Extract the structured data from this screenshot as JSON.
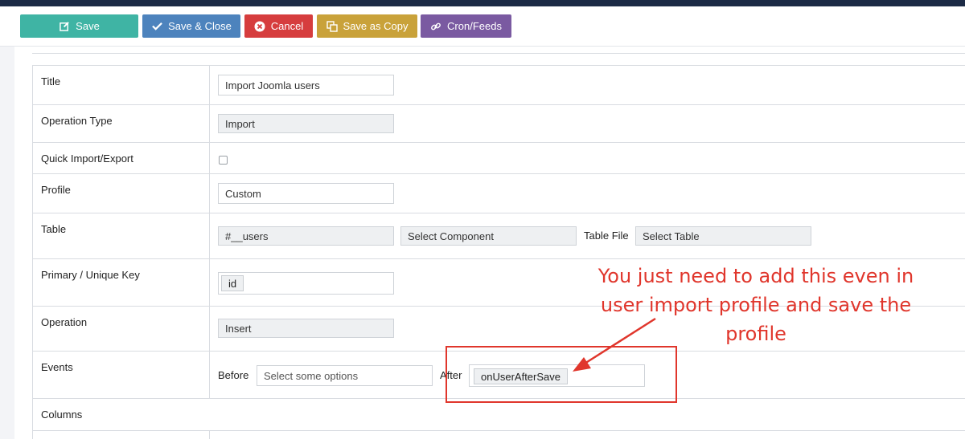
{
  "toolbar": {
    "save": "Save",
    "save_close": "Save & Close",
    "cancel": "Cancel",
    "save_copy": "Save as Copy",
    "cron": "Cron/Feeds"
  },
  "form": {
    "title": {
      "label": "Title",
      "value": "Import Joomla users"
    },
    "operation_type": {
      "label": "Operation Type",
      "value": "Import"
    },
    "quick": {
      "label": "Quick Import/Export",
      "checked": false
    },
    "profile": {
      "label": "Profile",
      "value": "Custom"
    },
    "table": {
      "label": "Table",
      "value": "#__users",
      "component_placeholder": "Select Component",
      "table_file_label": "Table File",
      "table_placeholder": "Select Table"
    },
    "primary_key": {
      "label": "Primary / Unique Key",
      "value": "id"
    },
    "operation": {
      "label": "Operation",
      "value": "Insert"
    },
    "events": {
      "label": "Events",
      "before_label": "Before",
      "before_placeholder": "Select some options",
      "after_label": "After",
      "after_value": "onUserAfterSave"
    },
    "columns": {
      "label": "Columns"
    }
  },
  "annotation": {
    "lines": [
      "You just need to add this even in",
      "user import profile and save the",
      "profile"
    ],
    "color": "#e0362c"
  },
  "colors": {
    "save": "#3fb4a4",
    "save_close": "#4d83bd",
    "cancel": "#d63d3e",
    "save_copy": "#c9a23a",
    "cron": "#7a5aa1"
  }
}
